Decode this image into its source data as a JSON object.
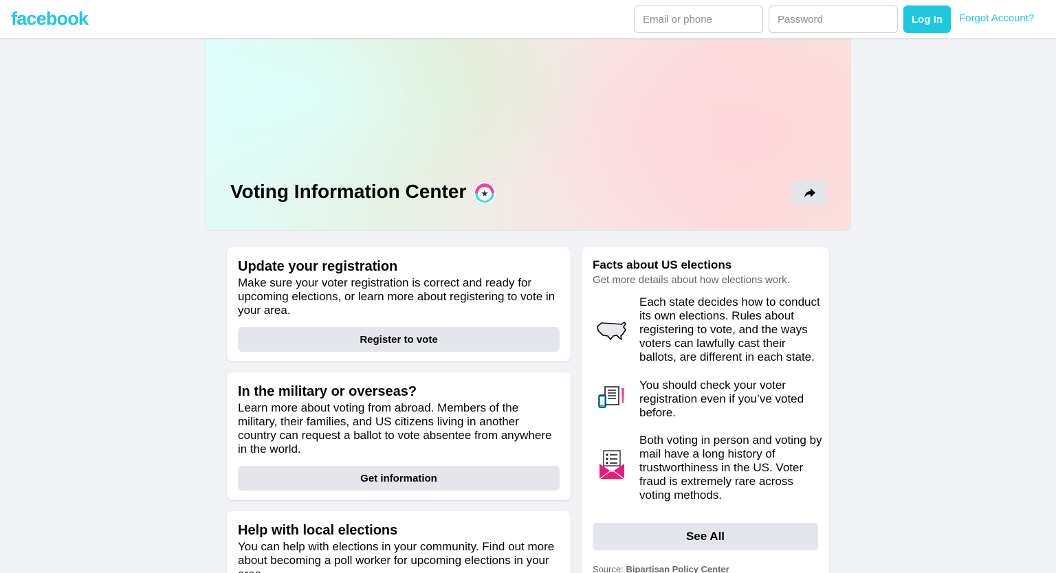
{
  "header": {
    "logo": "facebook",
    "email_placeholder": "Email or phone",
    "password_placeholder": "Password",
    "login_label": "Log In",
    "forgot_label": "Forgot Account?"
  },
  "cover": {
    "title": "Voting Information Center"
  },
  "cards": [
    {
      "title": "Update your registration",
      "body": "Make sure your voter registration is correct and ready for upcoming elections, or learn more about registering to vote in your area.",
      "button": "Register to vote"
    },
    {
      "title": "In the military or overseas?",
      "body": "Learn more about voting from abroad. Members of the military, their families, and US citizens living in another country can request a ballot to vote absentee from anywhere in the world.",
      "button": "Get information"
    },
    {
      "title": "Help with local elections",
      "body": "You can help with elections in your community. Find out more about becoming a poll worker for upcoming elections in your area."
    }
  ],
  "facts": {
    "title": "Facts about US elections",
    "subtitle": "Get more details about how elections work.",
    "items": [
      {
        "icon": "us-map-icon",
        "text": "Each state decides how to conduct its own elections. Rules about registering to vote, and the ways voters can lawfully cast their ballots, are different in each state."
      },
      {
        "icon": "phone-document-icon",
        "text": "You should check your voter registration even if you’ve voted before."
      },
      {
        "icon": "mail-ballot-icon",
        "text": "Both voting in person and voting by mail have a long history of trustworthiness in the US. Voter fraud is extremely rare across voting methods."
      }
    ],
    "see_all": "See All",
    "source_label": "Source:",
    "source_name": "Bipartisan Policy Center"
  },
  "colors": {
    "brand": "#1ec8e0",
    "button_bg": "#e4e6eb",
    "page_bg": "#f0f2f5",
    "badge_pink": "#f0449a",
    "badge_cyan": "#36dde7"
  }
}
